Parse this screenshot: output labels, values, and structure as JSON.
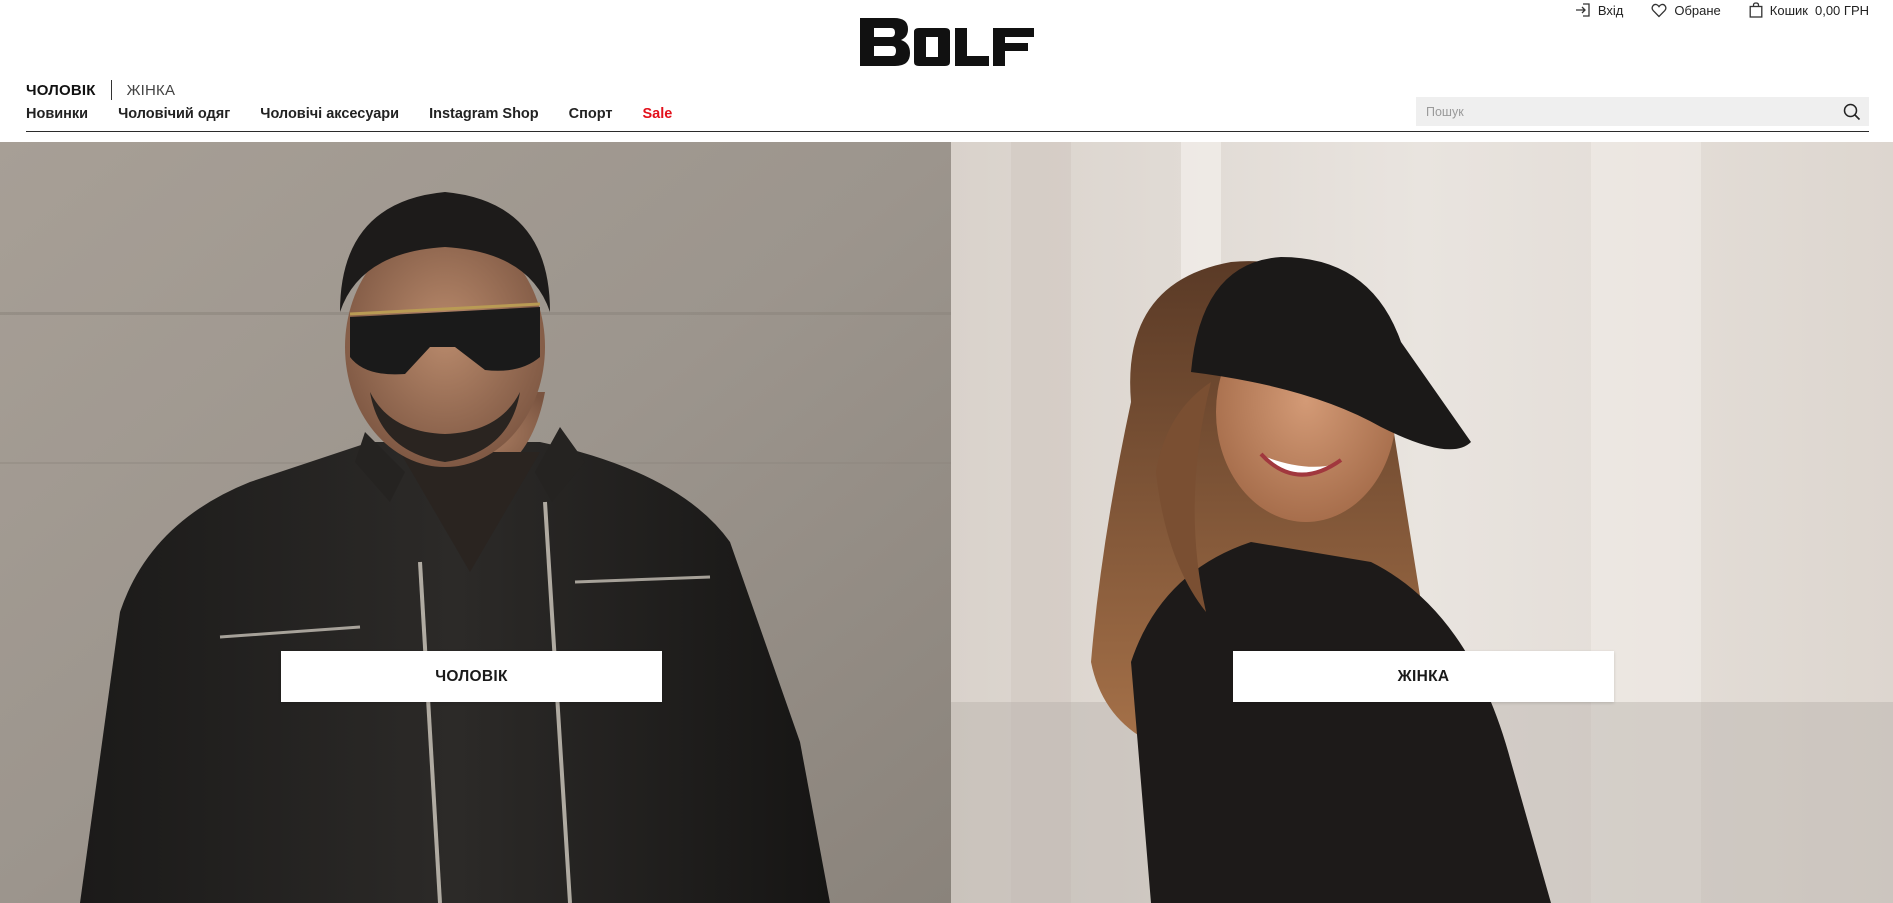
{
  "brand": {
    "logo_text": "BOLF"
  },
  "utility": {
    "login_label": "Вхід",
    "login_icon": "login-icon",
    "favorites_label": "Обране",
    "favorites_icon": "heart-icon",
    "cart_label": "Кошик",
    "cart_total": "0,00 ГРН",
    "cart_icon": "bag-icon"
  },
  "gender_switch": {
    "men": "ЧОЛОВІК",
    "women": "ЖІНКА",
    "active": "men"
  },
  "nav": {
    "items": [
      {
        "label": "Новинки"
      },
      {
        "label": "Чоловічий одяг"
      },
      {
        "label": "Чоловічі аксесуари"
      },
      {
        "label": "Instagram Shop"
      },
      {
        "label": "Спорт"
      },
      {
        "label": "Sale",
        "highlight": true
      }
    ]
  },
  "search": {
    "placeholder": "Пошук",
    "value": "",
    "icon": "search-icon"
  },
  "hero": {
    "men": {
      "button_label": "ЧОЛОВІК"
    },
    "women": {
      "button_label": "ЖІНКА"
    }
  },
  "colors": {
    "sale": "#e3101b",
    "search_bg": "#efefef",
    "text": "#222222"
  }
}
